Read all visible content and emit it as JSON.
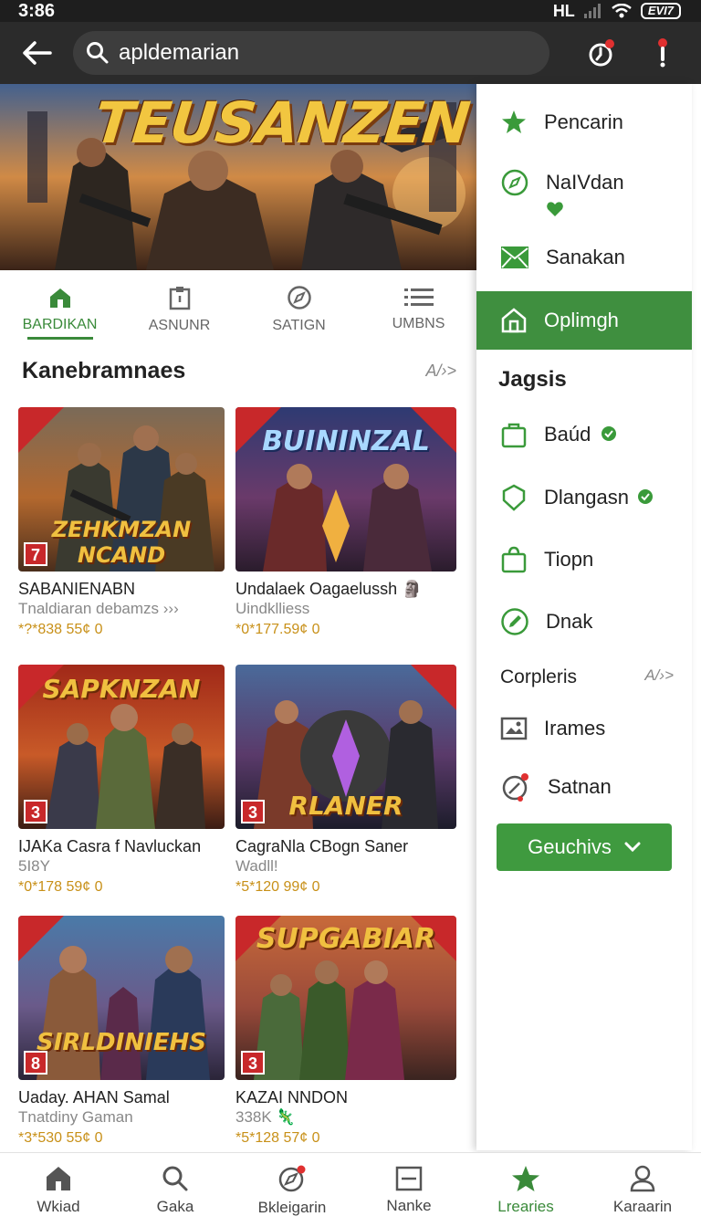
{
  "status": {
    "time": "3:86",
    "signal_label": "HL",
    "battery": "EVI7"
  },
  "search": {
    "value": "apldemarian"
  },
  "hero": {
    "title": "TEUSANZEN"
  },
  "tabs": [
    {
      "label": "BARDIKAN",
      "icon": "home-icon",
      "active": true
    },
    {
      "label": "ASNUNR",
      "icon": "clipboard-icon",
      "active": false
    },
    {
      "label": "SATIGN",
      "icon": "compass-icon",
      "active": false
    },
    {
      "label": "UMBNS",
      "icon": "list-icon",
      "active": false
    }
  ],
  "section": {
    "title": "Kanebramnaes",
    "more": "A/›>"
  },
  "games": [
    {
      "art_title": "ZEHKMZAN NCAND",
      "rank": "7",
      "title": "SABANIENABN",
      "subtitle": "Tnaldiaran debamzs ›››",
      "rating": "*?*838 55¢ 0"
    },
    {
      "art_title": "BUININZAL",
      "rank": "",
      "title": "Undalaek Oagaelussh 🗿",
      "subtitle": "Uindklliess",
      "rating": "*0*177.59¢ 0"
    },
    {
      "art_title": "SAPKNZAN",
      "rank": "3",
      "title": "IJAKa Casra f Navluckan",
      "subtitle": "5I8Y",
      "rating": "*0*178 59¢ 0"
    },
    {
      "art_title": "RLANER",
      "rank": "3",
      "title": "CagraNla CBogn Saner",
      "subtitle": "Wadll!",
      "rating": "*5*120 99¢ 0"
    },
    {
      "art_title": "SIRLDINIEHS",
      "rank": "8",
      "title": "Uaday. AHAN Samal",
      "subtitle": "Tnatdiny Gaman",
      "rating": "*3*530 55¢ 0"
    },
    {
      "art_title": "SUPGABIAR",
      "rank": "3",
      "title": "KAZAI NNDON",
      "subtitle": "338K 🦎",
      "rating": "*5*128 57¢ 0"
    }
  ],
  "drawer": {
    "items_top": [
      {
        "label": "Pencarin",
        "icon": "star-icon"
      },
      {
        "label": "NaIVdan",
        "icon": "compass-icon"
      },
      {
        "label": "Sanakan",
        "icon": "mail-icon"
      },
      {
        "label": "Oplimgh",
        "icon": "home-icon",
        "active": true
      }
    ],
    "heading": "Jagsis",
    "items_mid": [
      {
        "label": "Baúd",
        "icon": "bag-icon",
        "verified": true
      },
      {
        "label": "Dlangasn",
        "icon": "shield-icon",
        "verified": true
      },
      {
        "label": "Tiopn",
        "icon": "shopping-bag-icon",
        "verified": false
      },
      {
        "label": "Dnak",
        "icon": "edit-icon",
        "verified": false
      }
    ],
    "sub": {
      "label": "Corpleris",
      "more": "A/›>"
    },
    "items_bottom": [
      {
        "label": "Irames",
        "icon": "image-icon"
      },
      {
        "label": "Satnan",
        "icon": "settings-icon"
      }
    ],
    "button": {
      "label": "Geuchivs"
    }
  },
  "bottom_nav": [
    {
      "label": "Wkiad",
      "icon": "home-icon"
    },
    {
      "label": "Gaka",
      "icon": "search-icon"
    },
    {
      "label": "Bkleigarin",
      "icon": "compass-icon"
    },
    {
      "label": "Nanke",
      "icon": "library-icon"
    },
    {
      "label": "Lrearies",
      "icon": "star-icon",
      "active": true
    },
    {
      "label": "Karaarin",
      "icon": "person-icon"
    }
  ],
  "colors": {
    "accent": "#3f8f3f",
    "topbar": "#2b2b2b",
    "badge": "#c8282a"
  }
}
